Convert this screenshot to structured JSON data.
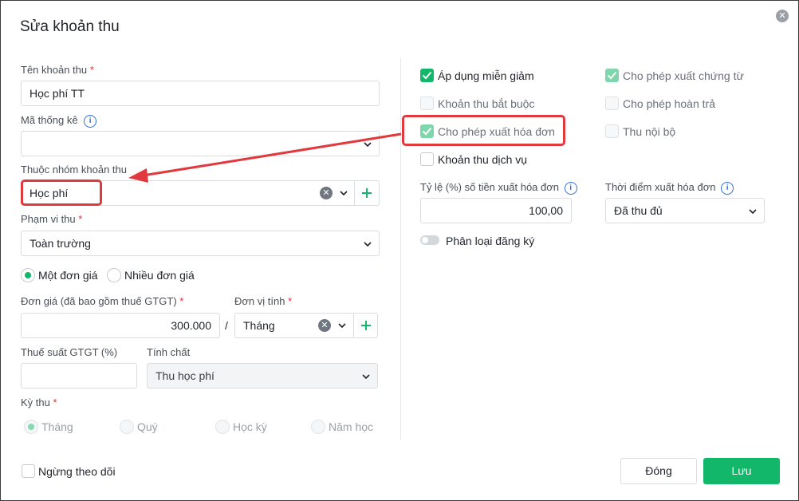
{
  "dialog": {
    "title": "Sửa khoản thu"
  },
  "left": {
    "ten_khoan_thu": {
      "label": "Tên khoản thu",
      "required": "*",
      "value": "Học phí TT"
    },
    "ma_thong_ke": {
      "label": "Mã thống kê",
      "value": ""
    },
    "thuoc_nhom": {
      "label": "Thuộc nhóm khoản thu",
      "value": "Học phí"
    },
    "pham_vi_thu": {
      "label": "Phạm vi thu",
      "required": "*",
      "value": "Toàn trường"
    },
    "don_gia_mode": {
      "options": [
        "Một đơn giá",
        "Nhiều đơn giá"
      ],
      "selected": "Một đơn giá"
    },
    "don_gia": {
      "label": "Đơn giá (đã bao gồm thuế GTGT)",
      "required": "*",
      "value": "300.000"
    },
    "separator": "/",
    "don_vi_tinh": {
      "label": "Đơn vị tính",
      "required": "*",
      "value": "Tháng"
    },
    "thue_suat": {
      "label": "Thuế suất GTGT (%)",
      "value": ""
    },
    "tinh_chat": {
      "label": "Tính chất",
      "value": "Thu học phí"
    },
    "ky_thu": {
      "label": "Kỳ thu",
      "required": "*",
      "options": [
        "Tháng",
        "Quý",
        "Học kỳ",
        "Năm học"
      ],
      "selected": "Tháng"
    }
  },
  "right": {
    "checkboxes": {
      "ap_dung_mien_giam": {
        "label": "Áp dụng miễn giảm",
        "checked": true
      },
      "khoan_thu_bat_buoc": {
        "label": "Khoản thu bắt buộc",
        "checked": false
      },
      "cho_phep_xuat_hoa_don": {
        "label": "Cho phép xuất hóa đơn",
        "checked": true
      },
      "khoan_thu_dich_vu": {
        "label": "Khoản thu dịch vụ",
        "checked": false
      },
      "cho_phep_xuat_chung_tu": {
        "label": "Cho phép xuất chứng từ",
        "checked": true
      },
      "cho_phep_hoan_tra": {
        "label": "Cho phép hoàn trả",
        "checked": false
      },
      "thu_noi_bo": {
        "label": "Thu nội bộ",
        "checked": false
      }
    },
    "ty_le": {
      "label": "Tỷ lệ (%) số tiền xuất hóa đơn",
      "value": "100,00"
    },
    "thoi_diem": {
      "label": "Thời điểm xuất hóa đơn",
      "value": "Đã thu đủ"
    },
    "phan_loai_dang_ky": {
      "label": "Phân loại đăng ký",
      "on": false
    }
  },
  "footer": {
    "ngung_theo_doi": {
      "label": "Ngừng theo dõi",
      "checked": false
    },
    "dong_label": "Đóng",
    "luu_label": "Lưu"
  },
  "colors": {
    "accent": "#12b76a",
    "highlight": "#e0393e",
    "info": "#2f6fe0"
  },
  "icons": [
    "close-icon",
    "info-icon",
    "chevron-down-icon",
    "clear-icon",
    "plus-icon",
    "check-icon"
  ]
}
